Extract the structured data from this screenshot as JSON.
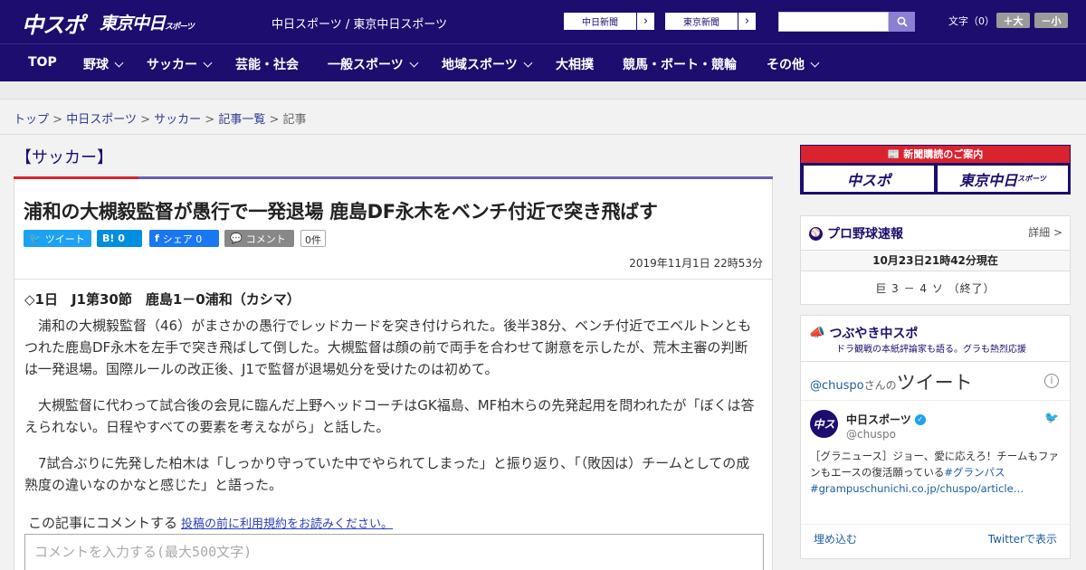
{
  "header": {
    "logo_main": "中スポ",
    "logo_tokyo": "東京中日",
    "logo_tokyo_sub": "スポーツ",
    "site_title": "中日スポーツ / 東京中日スポーツ",
    "ext_links": [
      "中日新聞",
      "東京新聞"
    ],
    "font_size_label": "文字（0）",
    "font_larger": "＋大",
    "font_smaller": "－小"
  },
  "nav": {
    "items": [
      {
        "label": "TOP",
        "dropdown": false
      },
      {
        "label": "野球",
        "dropdown": true
      },
      {
        "label": "サッカー",
        "dropdown": true
      },
      {
        "label": "芸能・社会",
        "dropdown": false
      },
      {
        "label": "一般スポーツ",
        "dropdown": true
      },
      {
        "label": "地域スポーツ",
        "dropdown": true
      },
      {
        "label": "大相撲",
        "dropdown": false
      },
      {
        "label": "競馬・ボート・競輪",
        "dropdown": false
      },
      {
        "label": "その他",
        "dropdown": true
      }
    ]
  },
  "breadcrumb": {
    "items": [
      "トップ",
      "中日スポーツ",
      "サッカー",
      "記事一覧"
    ],
    "current": "記事",
    "separator": ">"
  },
  "article": {
    "section": "【サッカー】",
    "title": "浦和の大槻毅監督が愚行で一発退場 鹿島DF永木をベンチ付近で突き飛ばす",
    "share": {
      "tweet": "ツイート",
      "hatena": "B! 0",
      "facebook": "シェア 0",
      "comment": "コメント",
      "comment_count": "0件"
    },
    "date": "2019年11月1日 22時53分",
    "subhead": "◇1日　J1第30節　鹿島1－0浦和（カシマ）",
    "paragraphs": [
      "浦和の大槻毅監督（46）がまさかの愚行でレッドカードを突き付けられた。後半38分、ベンチ付近でエベルトンともつれた鹿島DF永木を左手で突き飛ばして倒した。大槻監督は顔の前で両手を合わせて謝意を示したが、荒木主審の判断は一発退場。国際ルールの改正後、J1で監督が退場処分を受けたのは初めて。",
      "大槻監督に代わって試合後の会見に臨んだ上野ヘッドコーチはGK福島、MF柏木らの先発起用を問われたが「ぼくは答えられない。日程やすべての要素を考えながら」と話した。",
      "7試合ぶりに先発した柏木は「しっかり守っていた中でやられてしまった」と振り返り、「（敗因は）チームとしての成熟度の違いなのかなと感じた」と語った。"
    ],
    "comment_lead": "この記事にコメントする",
    "comment_rules_link": "投稿の前に利用規約をお読みください。",
    "comment_placeholder": "コメントを入力する(最大500文字)"
  },
  "sidebar": {
    "ad": {
      "heading": "新聞購読のご案内",
      "left": "中スポ",
      "right": "東京中日",
      "right_sub": "スポーツ"
    },
    "baseball": {
      "title": "プロ野球速報",
      "detail": "詳細 >",
      "status": "10月23日21時42分現在",
      "score": "巨 3 － 4 ソ （終了）"
    },
    "tweets": {
      "title": "つぶやき中スポ",
      "subtitle": "ドラ観戦の本紙評論家も語る。グラも熱烈応援",
      "handle": "@chuspo",
      "handle_suffix": "さんの",
      "heading": "ツイート",
      "tweet_name": "中日スポーツ",
      "tweet_user": "@chuspo",
      "tweet_text": "［グラニュース］ジョー、愛に応えろ！チームもファンもエースの復活願っている",
      "tweet_tag": "#グランパス",
      "tweet_link": "#grampuschunichi.co.jp/chuspo/article…",
      "embed": "埋め込む",
      "view_on_twitter": "Twitterで表示"
    }
  },
  "colors": {
    "brand_navy": "#1c0d6e",
    "accent_red": "#d9232f",
    "accent_purple": "#6b5fb3"
  }
}
